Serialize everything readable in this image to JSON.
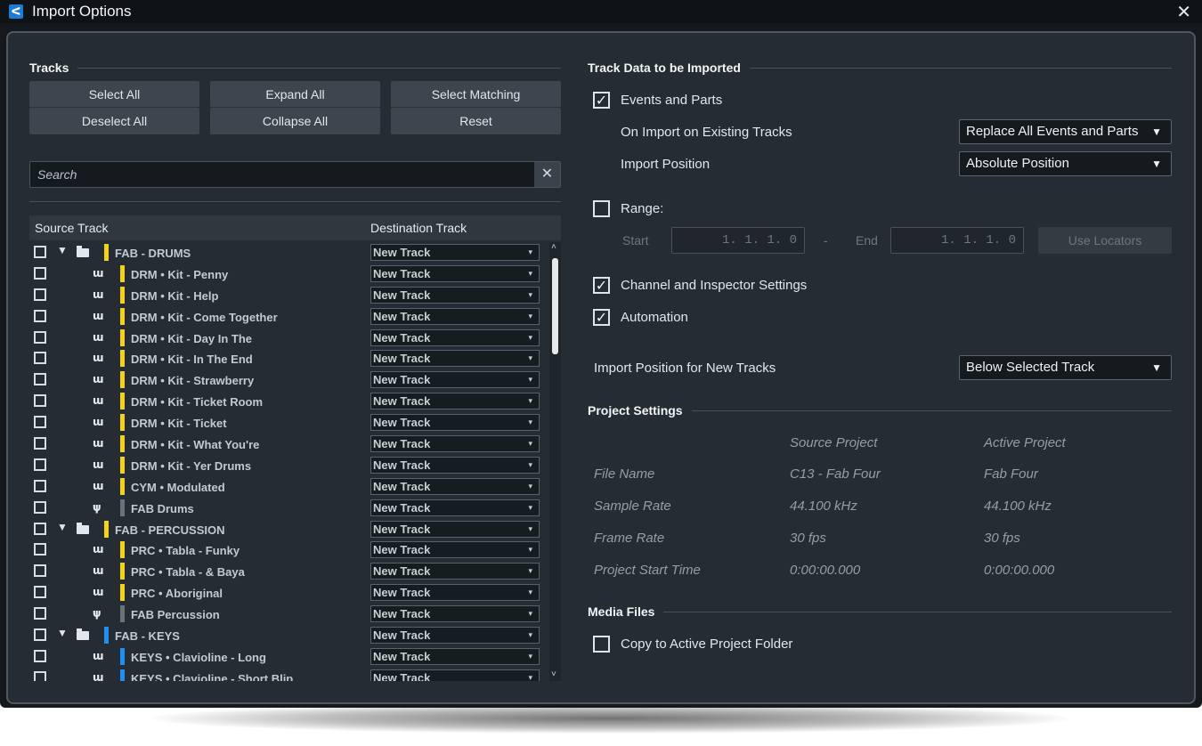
{
  "window": {
    "title": "Import Options",
    "close": "✕"
  },
  "tracks": {
    "section_title": "Tracks",
    "buttons": {
      "select_all": "Select All",
      "deselect_all": "Deselect All",
      "expand_all": "Expand All",
      "collapse_all": "Collapse All",
      "select_matching": "Select Matching",
      "reset": "Reset"
    },
    "search_placeholder": "Search",
    "search_clear": "✕",
    "columns": {
      "source": "Source Track",
      "destination": "Destination Track"
    },
    "rows": [
      {
        "name": "FAB - DRUMS",
        "kind": "folder",
        "color": "#f2d21b",
        "dest": "New Track"
      },
      {
        "name": "DRM • Kit - Penny",
        "kind": "instrument",
        "color": "#f2d21b",
        "dest": "New Track"
      },
      {
        "name": "DRM • Kit - Help",
        "kind": "instrument",
        "color": "#f2d21b",
        "dest": "New Track"
      },
      {
        "name": "DRM • Kit - Come Together",
        "kind": "instrument",
        "color": "#f2d21b",
        "dest": "New Track"
      },
      {
        "name": "DRM • Kit - Day In The",
        "kind": "instrument",
        "color": "#f2d21b",
        "dest": "New Track"
      },
      {
        "name": "DRM • Kit - In The End",
        "kind": "instrument",
        "color": "#f2d21b",
        "dest": "New Track"
      },
      {
        "name": "DRM • Kit - Strawberry",
        "kind": "instrument",
        "color": "#f2d21b",
        "dest": "New Track"
      },
      {
        "name": "DRM • Kit - Ticket Room",
        "kind": "instrument",
        "color": "#f2d21b",
        "dest": "New Track"
      },
      {
        "name": "DRM • Kit - Ticket",
        "kind": "instrument",
        "color": "#f2d21b",
        "dest": "New Track"
      },
      {
        "name": "DRM • Kit - What You're",
        "kind": "instrument",
        "color": "#f2d21b",
        "dest": "New Track"
      },
      {
        "name": "DRM • Kit - Yer Drums",
        "kind": "instrument",
        "color": "#f2d21b",
        "dest": "New Track"
      },
      {
        "name": "CYM • Modulated",
        "kind": "instrument",
        "color": "#f2d21b",
        "dest": "New Track"
      },
      {
        "name": "FAB Drums",
        "kind": "group",
        "color": "#6a737c",
        "dest": "New Track"
      },
      {
        "name": "FAB - PERCUSSION",
        "kind": "folder",
        "color": "#f2d21b",
        "dest": "New Track"
      },
      {
        "name": "PRC • Tabla - Funky",
        "kind": "instrument",
        "color": "#f2d21b",
        "dest": "New Track"
      },
      {
        "name": "PRC • Tabla - & Baya",
        "kind": "instrument",
        "color": "#f2d21b",
        "dest": "New Track"
      },
      {
        "name": "PRC • Aboriginal",
        "kind": "instrument",
        "color": "#f2d21b",
        "dest": "New Track"
      },
      {
        "name": "FAB Percussion",
        "kind": "group",
        "color": "#6a737c",
        "dest": "New Track"
      },
      {
        "name": "FAB - KEYS",
        "kind": "folder",
        "color": "#1f8ff0",
        "dest": "New Track"
      },
      {
        "name": "KEYS • Clavioline - Long",
        "kind": "instrument",
        "color": "#1f8ff0",
        "dest": "New Track"
      },
      {
        "name": "KEYS • Clavioline - Short Blip",
        "kind": "instrument",
        "color": "#1f8ff0",
        "dest": "New Track"
      }
    ]
  },
  "track_data": {
    "section_title": "Track Data to be Imported",
    "events_and_parts": {
      "label": "Events and Parts",
      "checked": true
    },
    "on_import_existing": {
      "label": "On Import on Existing Tracks",
      "value": "Replace All Events and Parts"
    },
    "import_position": {
      "label": "Import Position",
      "value": "Absolute Position"
    },
    "range": {
      "label": "Range:",
      "checked": false,
      "start_label": "Start",
      "start_value": "1. 1. 1.  0",
      "dash": "-",
      "end_label": "End",
      "end_value": "1. 1. 1.  0",
      "use_locators": "Use Locators"
    },
    "channel_inspector": {
      "label": "Channel and Inspector Settings",
      "checked": true
    },
    "automation": {
      "label": "Automation",
      "checked": true
    },
    "new_tracks_position": {
      "label": "Import Position for New Tracks",
      "value": "Below Selected Track"
    }
  },
  "project_settings": {
    "section_title": "Project Settings",
    "col_source": "Source Project",
    "col_active": "Active Project",
    "rows": [
      {
        "label": "File Name",
        "source": "C13 - Fab Four",
        "active": "Fab Four"
      },
      {
        "label": "Sample Rate",
        "source": "44.100 kHz",
        "active": "44.100 kHz"
      },
      {
        "label": "Frame Rate",
        "source": "30 fps",
        "active": "30 fps"
      },
      {
        "label": "Project Start Time",
        "source": "0:00:00.000",
        "active": "0:00:00.000"
      }
    ]
  },
  "media_files": {
    "section_title": "Media Files",
    "copy_to_active": {
      "label": "Copy to Active Project Folder",
      "checked": false
    }
  },
  "icons": {
    "checkmark": "✓",
    "dropdown": "▼",
    "small_dropdown": "▾",
    "folder_expand": "▼",
    "instrument_track": "ɯ",
    "group_track": "ψ",
    "scroll_up": "˄",
    "scroll_down": "˅",
    "app": "ᐸ"
  },
  "colors": {
    "accent_yellow": "#f2d21b",
    "accent_blue": "#1f8ff0",
    "panel": "#252c33"
  }
}
